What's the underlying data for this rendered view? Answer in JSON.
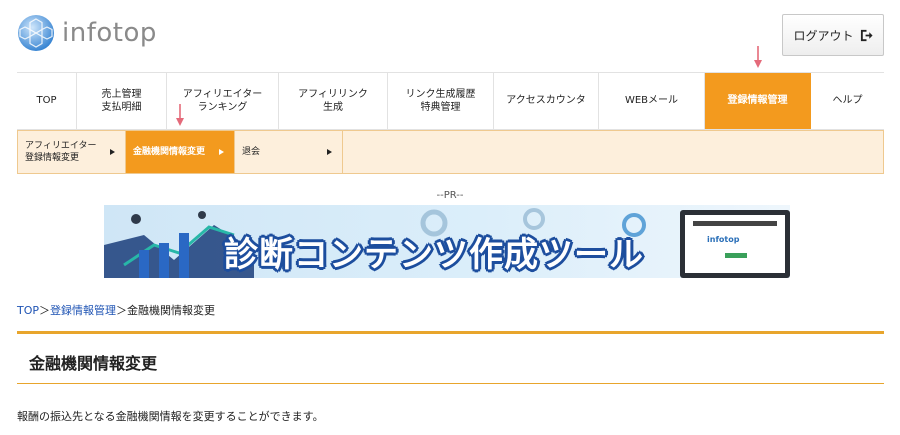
{
  "header": {
    "logo_text": "infotop",
    "logout_label": "ログアウト",
    "logout_icon": "sign-out-icon"
  },
  "main_nav": {
    "items": [
      {
        "label": "TOP",
        "active": false
      },
      {
        "label": "売上管理\n支払明細",
        "active": false
      },
      {
        "label": "アフィリエイター\nランキング",
        "active": false
      },
      {
        "label": "アフィリリンク\n生成",
        "active": false
      },
      {
        "label": "リンク生成履歴\n特典管理",
        "active": false
      },
      {
        "label": "アクセスカウンタ",
        "active": false
      },
      {
        "label": "WEBメール",
        "active": false
      },
      {
        "label": "登録情報管理",
        "active": true
      },
      {
        "label": "ヘルプ",
        "active": false
      }
    ]
  },
  "sub_nav": {
    "items": [
      {
        "label": "アフィリエイター\n登録情報変更",
        "active": false
      },
      {
        "label": "金融機関情報変更",
        "active": true
      },
      {
        "label": "退会",
        "active": false
      }
    ]
  },
  "ad": {
    "pr_label": "--PR--",
    "banner_text": "診断コンテンツ作成ツール",
    "screen_logo": "infotop"
  },
  "breadcrumb": {
    "home": "TOP",
    "sep1": "＞",
    "section": "登録情報管理",
    "sep2": "＞",
    "current": "金融機関情報変更"
  },
  "page": {
    "title": "金融機関情報変更",
    "description": "報酬の振込先となる金融機関情報を変更することができます。"
  },
  "colors": {
    "accent": "#f39a1e",
    "subnav_bg": "#fdefdc",
    "link": "#1f54b4",
    "indicator_arrow": "#e46a7a"
  }
}
